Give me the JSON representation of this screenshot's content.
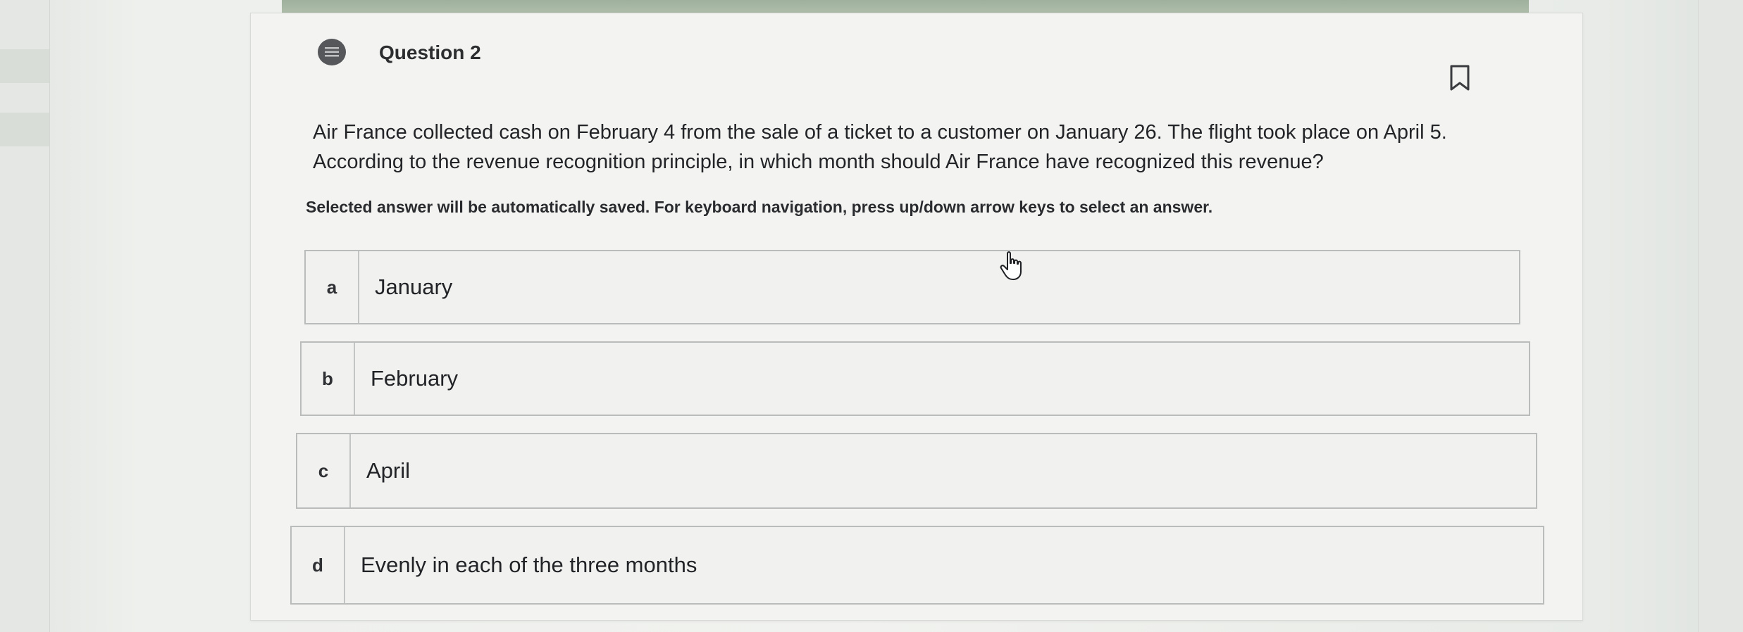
{
  "question": {
    "title": "Question 2",
    "text_line1": "Air France collected cash on February 4 from the sale of a ticket to a customer on January 26. The flight took place on April 5.",
    "text_line2": "According to the revenue recognition principle, in which month should Air France have recognized this revenue?",
    "instructions": "Selected answer will be automatically saved. For keyboard navigation, press up/down arrow keys to select an answer."
  },
  "choices": [
    {
      "letter": "a",
      "label": "January"
    },
    {
      "letter": "b",
      "label": "February"
    },
    {
      "letter": "c",
      "label": "April"
    },
    {
      "letter": "d",
      "label": "Evenly in each of the three months"
    }
  ],
  "icons": {
    "question_icon": "list-icon",
    "bookmark_icon": "bookmark-icon",
    "cursor": "hand-pointer-icon"
  },
  "colors": {
    "card_background": "#f3f4f2",
    "choice_border": "#b9bcbb",
    "text": "#232427",
    "top_strip": "#9fb19c"
  }
}
